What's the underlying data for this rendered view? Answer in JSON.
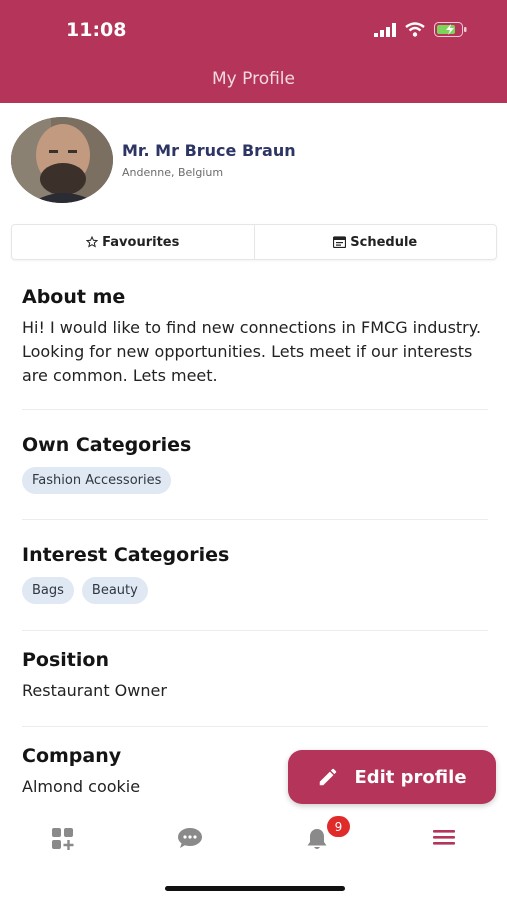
{
  "status_bar": {
    "time": "11:08"
  },
  "header": {
    "title": "My Profile"
  },
  "profile": {
    "name": "Mr. Mr Bruce Braun",
    "location": "Andenne, Belgium"
  },
  "tabs": [
    {
      "label": "Favourites",
      "icon": "star-icon"
    },
    {
      "label": "Schedule",
      "icon": "calendar-icon"
    }
  ],
  "about": {
    "heading": "About me",
    "text": "Hi! I would like to find new connections in FMCG industry. Looking for new opportunities. Lets meet if our interests are common. Lets meet."
  },
  "own_categories": {
    "heading": "Own Categories",
    "items": [
      "Fashion Accessories"
    ]
  },
  "interest_categories": {
    "heading": "Interest Categories",
    "items": [
      "Bags",
      "Beauty"
    ]
  },
  "position": {
    "heading": "Position",
    "value": "Restaurant Owner"
  },
  "company": {
    "heading": "Company",
    "value": "Almond cookie"
  },
  "edit_button": {
    "label": "Edit profile",
    "icon": "pencil-icon"
  },
  "bottom_nav": {
    "items": [
      "dashboard-icon",
      "chat-icon",
      "bell-icon",
      "menu-icon"
    ],
    "notification_count": "9"
  },
  "colors": {
    "primary": "#b5345a",
    "chip": "#dfe8f3",
    "name": "#2d3564"
  }
}
